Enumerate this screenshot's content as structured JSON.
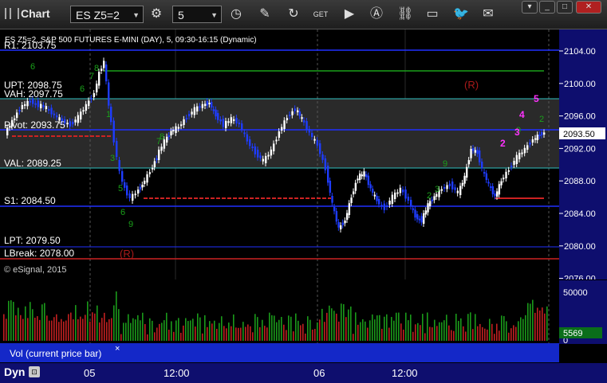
{
  "toolbar": {
    "title": "Chart",
    "symbol": "ES Z5=2",
    "interval": "5",
    "icons": [
      "pencil-icon",
      "refresh-icon",
      "get-icon",
      "play-icon",
      "text-icon",
      "link-icon",
      "comment-icon",
      "twitter-icon",
      "email-icon"
    ]
  },
  "chart": {
    "header": "ES Z5=2, S&P 500 FUTURES E-MINI (DAY), 5, 09:30-16:15 (Dynamic)",
    "copyright": "© eSignal, 2015",
    "levels": {
      "r1": "R1: 2103.75",
      "upt": "UPT: 2098.75",
      "vah": "VAH: 2097.75",
      "pivot": "Pivot: 2093.75",
      "val": "VAL: 2089.25",
      "s1": "S1: 2084.50",
      "lpt": "LPT: 2079.50",
      "lbreak": "LBreak: 2078.00"
    },
    "r_marker": "(R)",
    "last_price": "2093.50",
    "last_volume": "5569",
    "colors": {
      "up": "#ffffff",
      "down": "#1e3cff",
      "bg": "#000000",
      "axis": "#0e0e6e",
      "green": "#1a8a1a",
      "red": "#cc2222",
      "magenta": "#ff33ff"
    }
  },
  "chart_data": {
    "type": "candlestick",
    "y_ticks": [
      "2104.00",
      "2100.00",
      "2096.00",
      "2092.00",
      "2088.00",
      "2084.00",
      "2080.00",
      "2076.00"
    ],
    "vol_ticks": [
      "50000",
      "0"
    ],
    "x_ticks": [
      "05",
      "12:00",
      "06",
      "12:00"
    ],
    "ylim": [
      2076,
      2106
    ]
  },
  "volume_panel": {
    "label": "Vol (current price bar)",
    "close": "×"
  },
  "footer": {
    "dyn": "Dyn"
  }
}
